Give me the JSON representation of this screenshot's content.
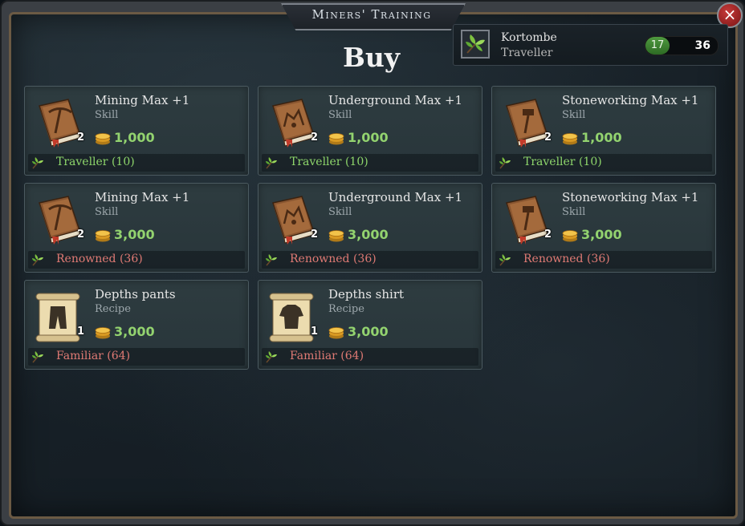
{
  "window": {
    "title": "Miners' Training",
    "close_label": "×",
    "heading": "Buy"
  },
  "player": {
    "name": "Kortombe",
    "status": "Traveller",
    "level": "17",
    "reputation": "36",
    "level_fraction": 0.33,
    "icon": "leaf-emblem-icon"
  },
  "colors": {
    "price": "#93d36f",
    "requirement_met": "#8ed66b",
    "requirement_unmet": "#e07a74"
  },
  "items": [
    {
      "name": "Mining Max +1",
      "type": "Skill",
      "qty": "2",
      "price": "1,000",
      "requirement": "Traveller (10)",
      "met": true,
      "icon": "pickaxe-book-icon"
    },
    {
      "name": "Underground Max +1",
      "type": "Skill",
      "qty": "2",
      "price": "1,000",
      "requirement": "Traveller (10)",
      "met": true,
      "icon": "underground-book-icon"
    },
    {
      "name": "Stoneworking Max +1",
      "type": "Skill",
      "qty": "2",
      "price": "1,000",
      "requirement": "Traveller (10)",
      "met": true,
      "icon": "hammer-book-icon"
    },
    {
      "name": "Mining Max +1",
      "type": "Skill",
      "qty": "2",
      "price": "3,000",
      "requirement": "Renowned (36)",
      "met": false,
      "icon": "pickaxe-book-icon"
    },
    {
      "name": "Underground Max +1",
      "type": "Skill",
      "qty": "2",
      "price": "3,000",
      "requirement": "Renowned (36)",
      "met": false,
      "icon": "underground-book-icon"
    },
    {
      "name": "Stoneworking Max +1",
      "type": "Skill",
      "qty": "2",
      "price": "3,000",
      "requirement": "Renowned (36)",
      "met": false,
      "icon": "hammer-book-icon"
    },
    {
      "name": "Depths pants",
      "type": "Recipe",
      "qty": "1",
      "price": "3,000",
      "requirement": "Familiar (64)",
      "met": false,
      "icon": "pants-scroll-icon"
    },
    {
      "name": "Depths shirt",
      "type": "Recipe",
      "qty": "1",
      "price": "3,000",
      "requirement": "Familiar (64)",
      "met": false,
      "icon": "shirt-scroll-icon"
    }
  ]
}
